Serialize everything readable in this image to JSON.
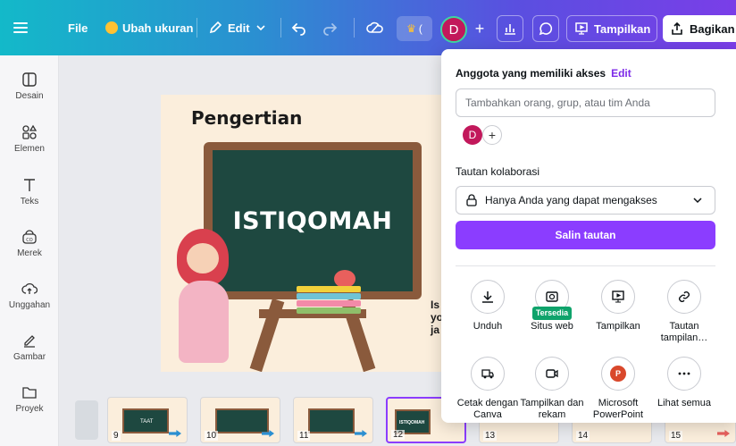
{
  "topbar": {
    "file_label": "File",
    "resize_label": "Ubah ukuran",
    "edit_label": "Edit",
    "crown_label": "(",
    "avatar_initial": "D",
    "present_label": "Tampilkan",
    "share_label": "Bagikan"
  },
  "sidebar": {
    "items": [
      {
        "label": "Desain",
        "icon": "layout-icon"
      },
      {
        "label": "Elemen",
        "icon": "shapes-icon"
      },
      {
        "label": "Teks",
        "icon": "text-icon"
      },
      {
        "label": "Merek",
        "icon": "brand-icon"
      },
      {
        "label": "Unggahan",
        "icon": "upload-icon"
      },
      {
        "label": "Gambar",
        "icon": "draw-icon"
      },
      {
        "label": "Proyek",
        "icon": "folder-icon"
      }
    ]
  },
  "slide": {
    "title": "Pengertian",
    "board_text": "ISTIQOMAH",
    "side_text": [
      "Is",
      "yo",
      "ja"
    ]
  },
  "share_panel": {
    "access_label": "Anggota yang memiliki akses",
    "edit_link": "Edit",
    "invite_placeholder": "Tambahkan orang, grup, atau tim Anda",
    "member_initial": "D",
    "collab_label": "Tautan kolaborasi",
    "access_option": "Hanya Anda yang dapat mengakses",
    "copy_link_label": "Salin tautan",
    "options": [
      {
        "label": "Unduh",
        "icon": "download-icon"
      },
      {
        "label": "Situs web",
        "icon": "website-icon",
        "badge": "Tersedia"
      },
      {
        "label": "Tampilkan",
        "icon": "present-icon"
      },
      {
        "label": "Tautan tampilan…",
        "icon": "link-icon"
      },
      {
        "label": "Cetak dengan Canva",
        "icon": "print-truck-icon"
      },
      {
        "label": "Tampilkan dan rekam",
        "icon": "record-icon"
      },
      {
        "label": "Microsoft PowerPoint",
        "icon": "powerpoint-icon"
      },
      {
        "label": "Lihat semua",
        "icon": "more-icon"
      }
    ]
  },
  "filmstrip": {
    "pages": [
      "9",
      "10",
      "11",
      "12",
      "13",
      "14",
      "15"
    ],
    "active_page": "12",
    "page_titles": [
      "TAAT",
      "",
      "",
      "ISTIQOMAH",
      "",
      "",
      ""
    ]
  },
  "colors": {
    "accent": "#8b3dff",
    "brand_gradient_start": "#13b9c9",
    "brand_gradient_end": "#7a3ee8",
    "badge_green": "#0fa36b"
  }
}
